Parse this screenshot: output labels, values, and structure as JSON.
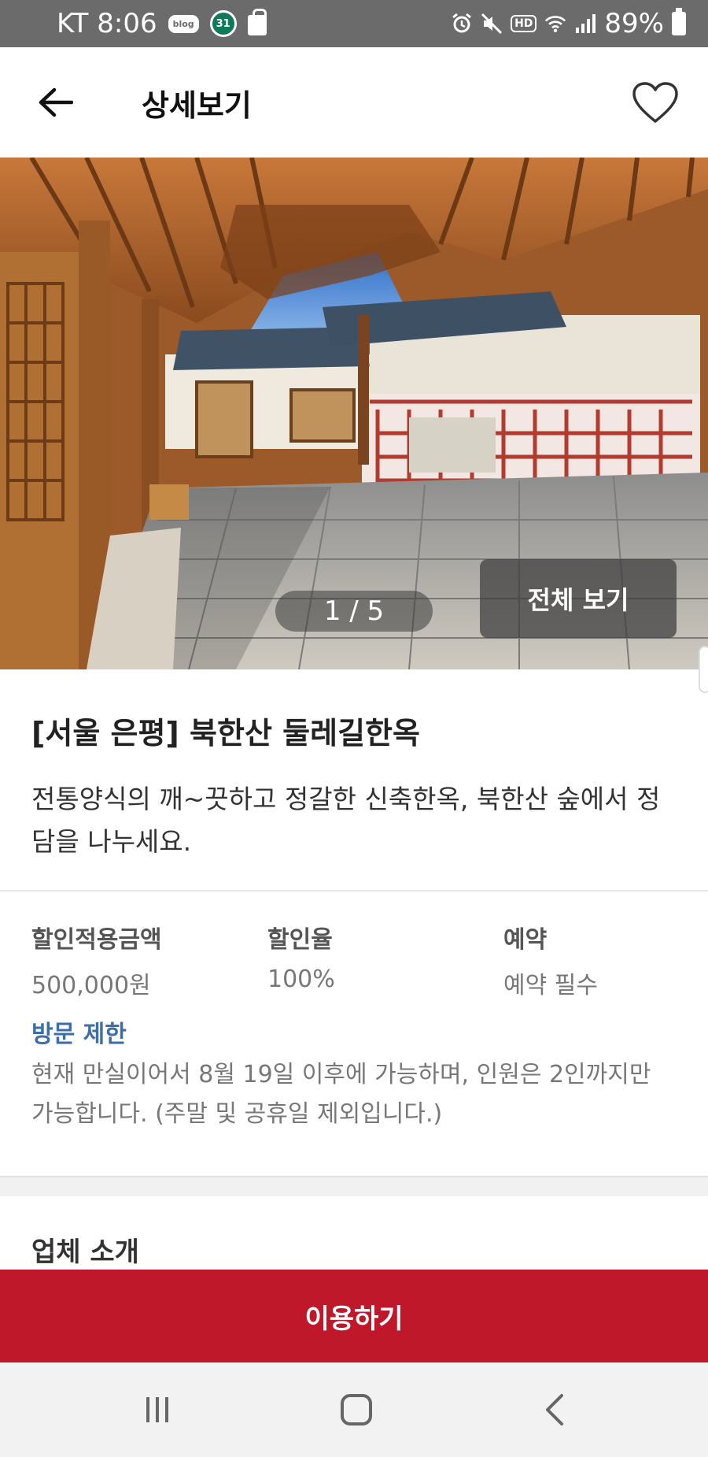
{
  "status_bar": {
    "carrier_time": "KT 8:06",
    "blog_badge": "blog",
    "calendar_badge": "31",
    "hd_badge": "HD",
    "battery": "89%"
  },
  "header": {
    "title": "상세보기"
  },
  "gallery": {
    "counter": "1 / 5",
    "view_all": "전체 보기"
  },
  "listing": {
    "title": "[서울 은평] 북한산 둘레길한옥",
    "description": "전통양식의 깨~끗하고 정갈한 신축한옥, 북한산 숲에서 정담을 나누세요."
  },
  "info": [
    {
      "label": "할인적용금액",
      "value": "500,000원"
    },
    {
      "label": "할인율",
      "value": "100%"
    },
    {
      "label": "예약",
      "value": "예약 필수"
    }
  ],
  "restriction": {
    "label": "방문 제한",
    "text": "현재 만실이어서 8월 19일 이후에 가능하며, 인원은 2인까지만 가능합니다. (주말 및 공휴일 제외입니다.)"
  },
  "company": {
    "title": "업체 소개"
  },
  "cta": {
    "label": "이용하기"
  },
  "colors": {
    "cta": "#c0182b",
    "restriction_label": "#3e6ea8",
    "status_bar": "#6b6b6b"
  }
}
